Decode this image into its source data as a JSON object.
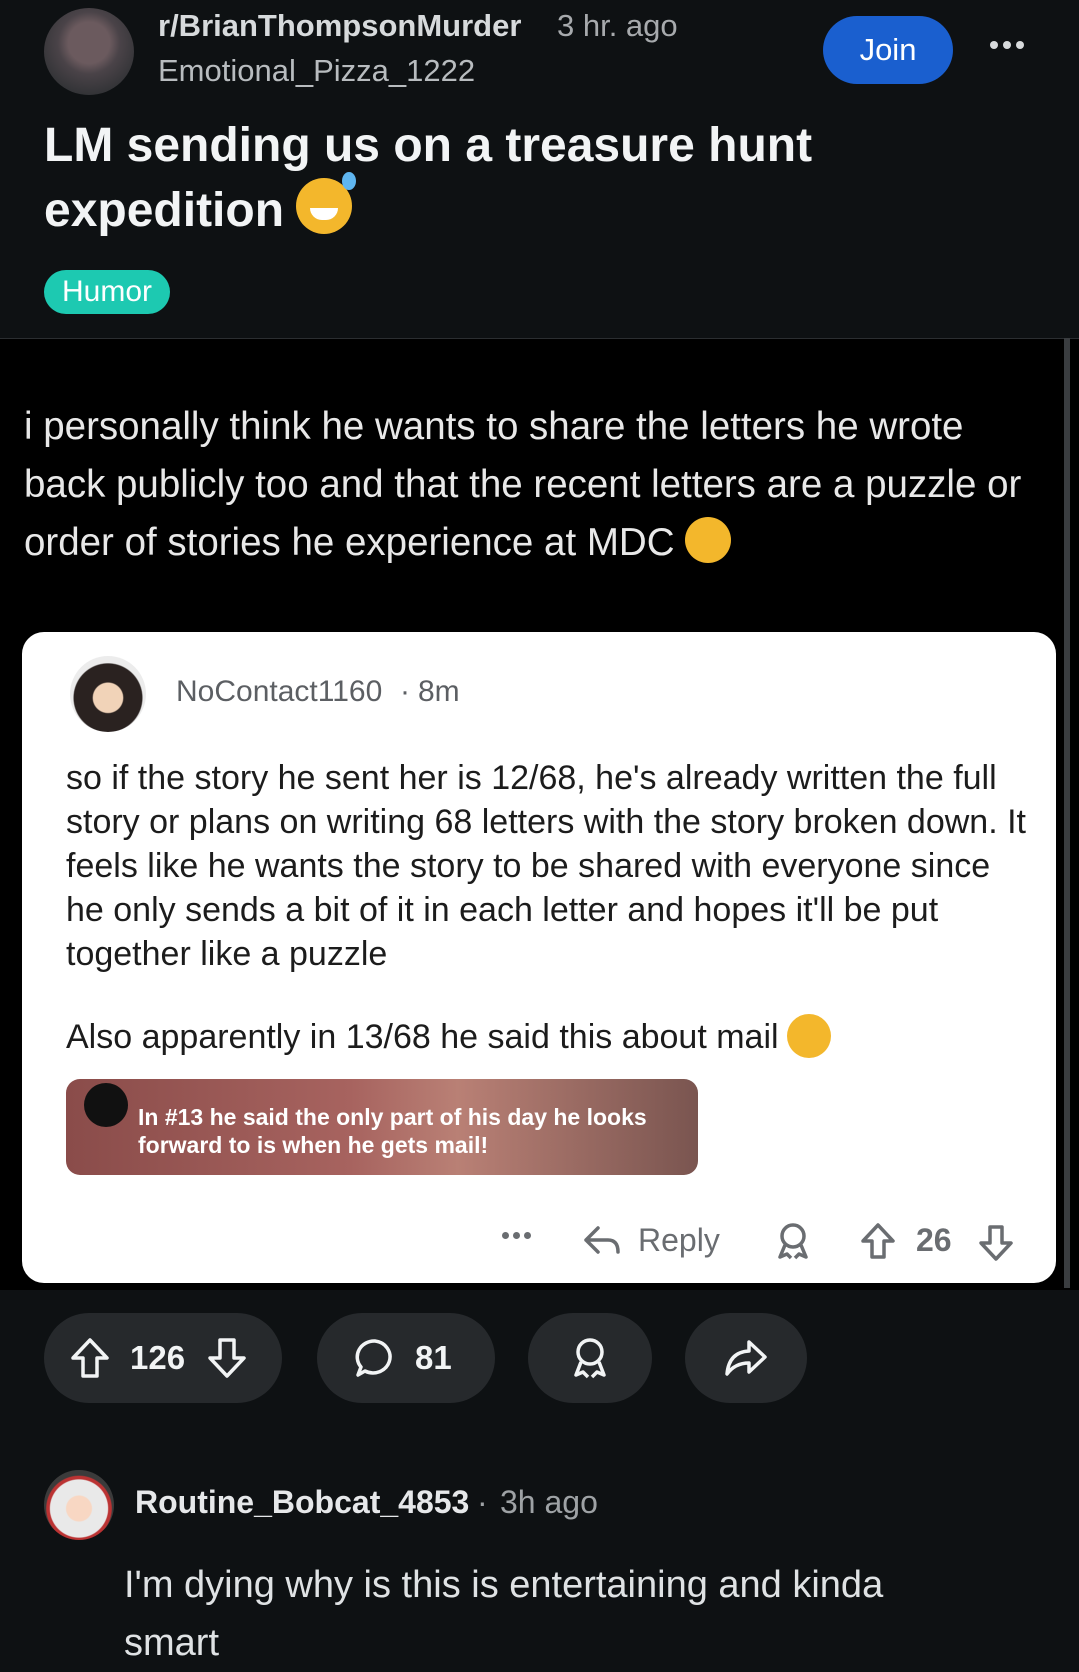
{
  "post": {
    "subreddit": "r/BrianThompsonMurder",
    "time": "3 hr. ago",
    "author": "Emotional_Pizza_1222",
    "join_label": "Join",
    "title": "LM sending us on a treasure hunt expedition",
    "flair": "Humor",
    "flair_color": "#1dc9b1"
  },
  "screenshot": {
    "quote": "i personally think he wants to share the letters he wrote back publicly too and that the recent letters are a puzzle or order of stories he experience at MDC",
    "comment": {
      "author": "NoContact1160",
      "time": "8m",
      "body": "so if the story he sent her is 12/68, he's already written the full story or plans on writing 68 letters with the story broken down. It feels like he wants the story to be shared with everyone since he only sends a bit of it in each letter and hopes it'll be put together like a puzzle",
      "body2": "Also apparently in 13/68 he said this about mail",
      "banner_text": "In #13 he said the only part of his day he looks forward to is when he gets mail!",
      "reply_label": "Reply",
      "votes": "26"
    }
  },
  "actions": {
    "votes": "126",
    "comments": "81"
  },
  "top_comment": {
    "author": "Routine_Bobcat_4853",
    "time": "3h ago",
    "text": "I'm dying why is this is entertaining and kinda smart"
  },
  "colors": {
    "background": "#0e1113",
    "join_button": "#1a5fcf",
    "pill": "#26292c"
  }
}
